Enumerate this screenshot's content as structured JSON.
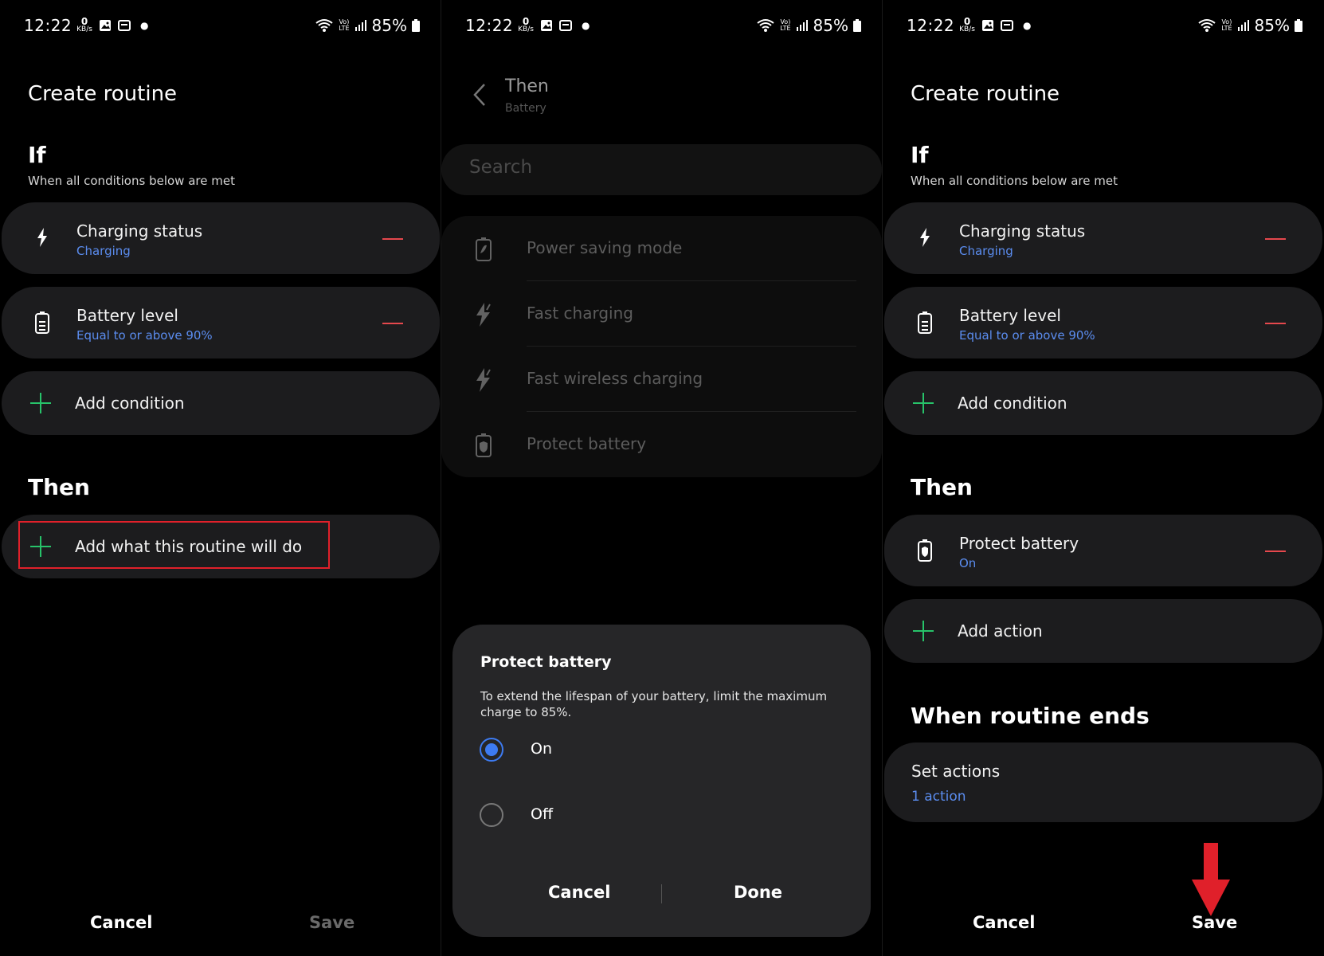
{
  "status_bar": {
    "time": "12:22",
    "kbs_value": "0",
    "kbs_unit": "KB/s",
    "volte_top": "Vo)",
    "volte_bottom": "LTE",
    "battery_percent": "85%"
  },
  "panel1": {
    "title": "Create routine",
    "if_heading": "If",
    "if_subtitle": "When all conditions below are met",
    "conditions": [
      {
        "label": "Charging status",
        "value": "Charging"
      },
      {
        "label": "Battery level",
        "value": "Equal to or above 90%"
      }
    ],
    "add_condition": "Add condition",
    "then_heading": "Then",
    "add_action": "Add what this routine will do",
    "cancel": "Cancel",
    "save": "Save"
  },
  "panel2": {
    "title": "Then",
    "subtitle": "Battery",
    "search_placeholder": "Search",
    "items": [
      "Power saving mode",
      "Fast charging",
      "Fast wireless charging",
      "Protect battery"
    ],
    "dialog": {
      "title": "Protect battery",
      "description": "To extend the lifespan of your battery, limit the maximum charge to 85%.",
      "options": [
        {
          "label": "On",
          "selected": true
        },
        {
          "label": "Off",
          "selected": false
        }
      ],
      "cancel": "Cancel",
      "done": "Done"
    }
  },
  "panel3": {
    "title": "Create routine",
    "if_heading": "If",
    "if_subtitle": "When all conditions below are met",
    "conditions": [
      {
        "label": "Charging status",
        "value": "Charging"
      },
      {
        "label": "Battery level",
        "value": "Equal to or above 90%"
      }
    ],
    "add_condition": "Add condition",
    "then_heading": "Then",
    "actions": [
      {
        "label": "Protect battery",
        "value": "On"
      }
    ],
    "add_action": "Add action",
    "ends_heading": "When routine ends",
    "set_actions": "Set actions",
    "set_actions_count": "1 action",
    "cancel": "Cancel",
    "save": "Save"
  },
  "colors": {
    "accent_blue": "#5b8df0",
    "plus_green": "#27c36a",
    "minus_red": "#e5484d",
    "highlight_red": "#e0202a",
    "card_bg": "#1c1c1e"
  }
}
